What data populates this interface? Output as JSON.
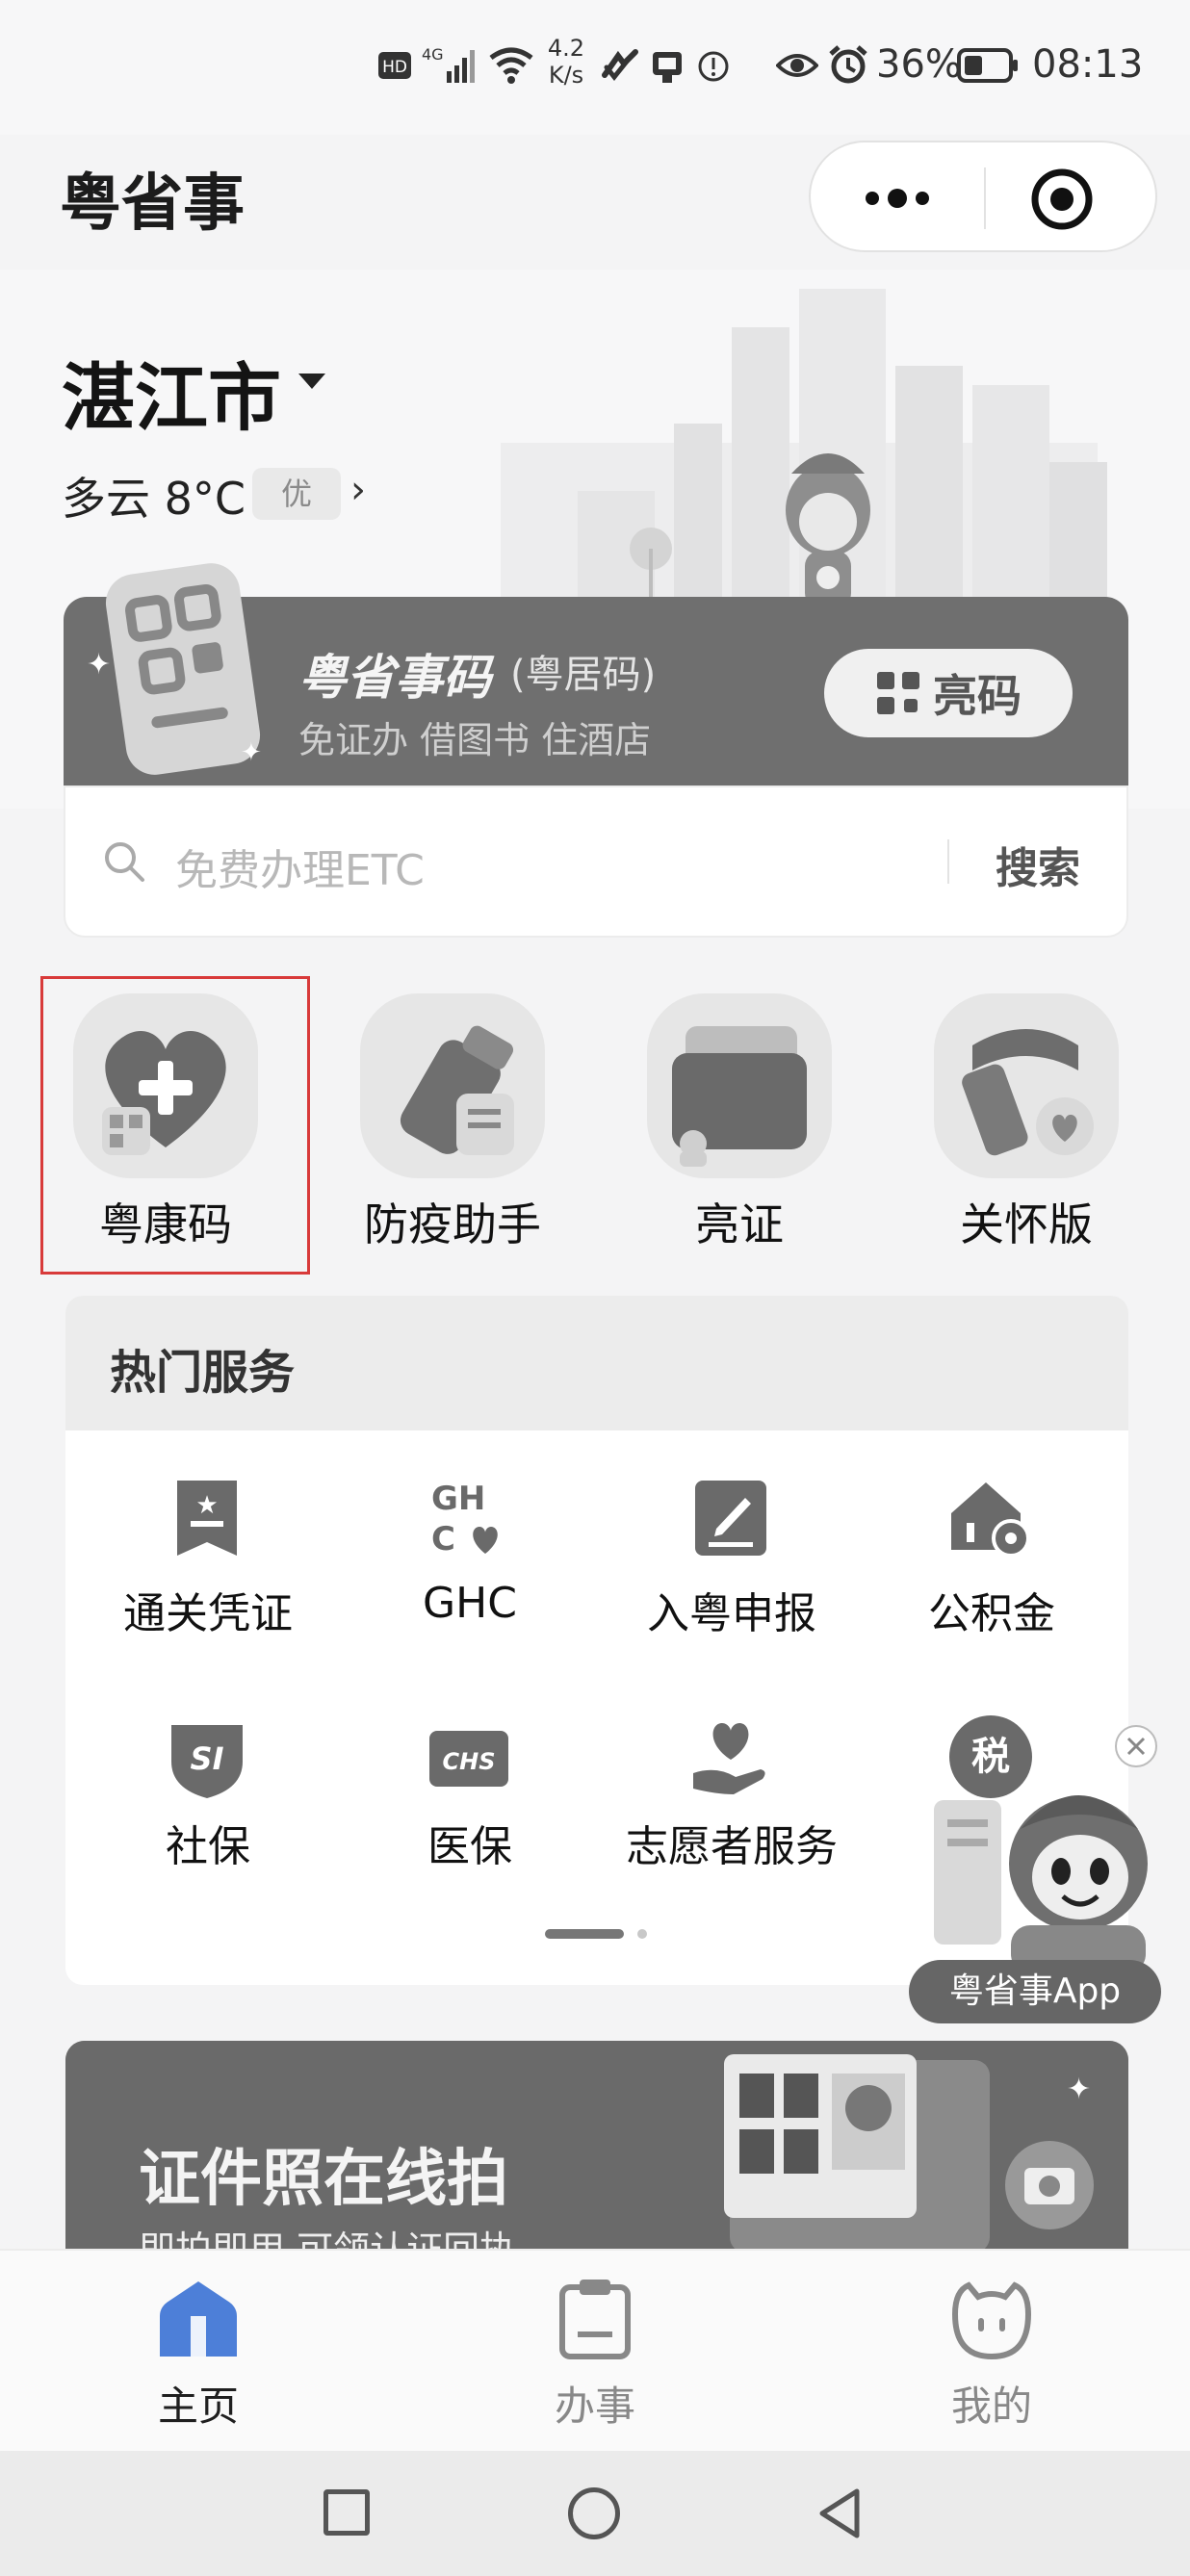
{
  "status_bar": {
    "net_speed_value": "4.2",
    "net_speed_unit": "K/s",
    "battery": "36%",
    "time": "08:13",
    "icons": [
      "hd-icon",
      "signal-4g-icon",
      "wifi-icon",
      "nfc-icon",
      "sim-icon",
      "alert-icon",
      "eye-icon",
      "alarm-icon",
      "battery-icon"
    ]
  },
  "header": {
    "title": "粤省事",
    "more_icon": "more-dots-icon",
    "target_icon": "target-icon"
  },
  "location": {
    "city": "湛江市",
    "weather": "多云 8°C",
    "aqi": "优"
  },
  "code_card": {
    "title": "粤省事码",
    "subtitle": "(粤居码)",
    "desc": "免证办 借图书 住酒店",
    "button_label": "亮码"
  },
  "search": {
    "placeholder": "免费办理ETC",
    "button_label": "搜索"
  },
  "quick_entries": [
    {
      "label": "粤康码",
      "icon": "heart-plus-icon"
    },
    {
      "label": "防疫助手",
      "icon": "sprayer-icon"
    },
    {
      "label": "亮证",
      "icon": "wallet-icon"
    },
    {
      "label": "关怀版",
      "icon": "scarf-icon"
    }
  ],
  "hot_services": {
    "title": "热门服务",
    "items": [
      {
        "label": "通关凭证",
        "icon": "ticket-star-icon"
      },
      {
        "label": "GHC",
        "icon": "ghc-icon"
      },
      {
        "label": "入粤申报",
        "icon": "edit-form-icon"
      },
      {
        "label": "公积金",
        "icon": "house-coin-icon"
      },
      {
        "label": "社保",
        "icon": "si-shield-icon"
      },
      {
        "label": "医保",
        "icon": "chs-card-icon"
      },
      {
        "label": "志愿者服务",
        "icon": "hand-heart-icon"
      },
      {
        "label": "税",
        "icon": "tax-icon"
      }
    ]
  },
  "floating_promo": {
    "label": "粤省事App"
  },
  "banner": {
    "title": "证件照在线拍",
    "subtitle": "即拍即用 可领认证回执"
  },
  "bottom_nav": [
    {
      "label": "主页",
      "icon": "home-icon",
      "active": true
    },
    {
      "label": "办事",
      "icon": "clipboard-icon",
      "active": false
    },
    {
      "label": "我的",
      "icon": "profile-face-icon",
      "active": false
    }
  ],
  "colors": {
    "active_tab": "#1f1f1f",
    "inactive_tab": "#888888",
    "active_home_icon": "#4d7fd8",
    "highlight_border": "#d83a3a"
  }
}
